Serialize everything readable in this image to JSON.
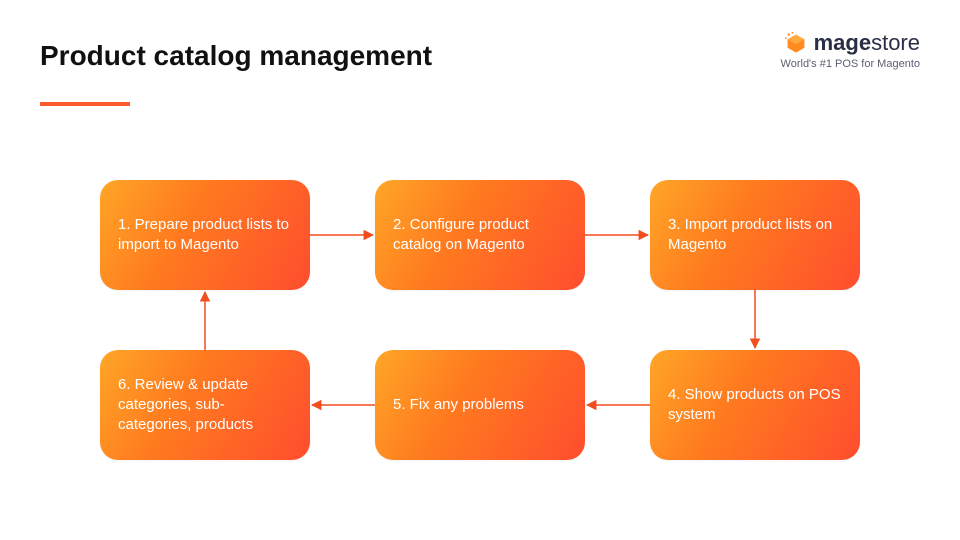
{
  "header": {
    "title": "Product catalog management"
  },
  "brand": {
    "name_bold": "mage",
    "name_light": "store",
    "tagline": "World's #1 POS for Magento"
  },
  "nodes": {
    "n1": "1. Prepare product lists to import to Magento",
    "n2": "2. Configure product catalog on Magento",
    "n3": "3. Import product lists on Magento",
    "n4": "4. Show products on POS system",
    "n5": "5. Fix any problems",
    "n6": "6. Review & update categories, sub-categories, products"
  },
  "colors": {
    "accent": "#ff5a2b",
    "node_grad_start": "#ffa627",
    "node_grad_end": "#ff4d2e",
    "arrow": "#f24d1f"
  },
  "flow_edges": [
    [
      "n1",
      "n2"
    ],
    [
      "n2",
      "n3"
    ],
    [
      "n3",
      "n4"
    ],
    [
      "n4",
      "n5"
    ],
    [
      "n5",
      "n6"
    ],
    [
      "n6",
      "n1"
    ]
  ]
}
